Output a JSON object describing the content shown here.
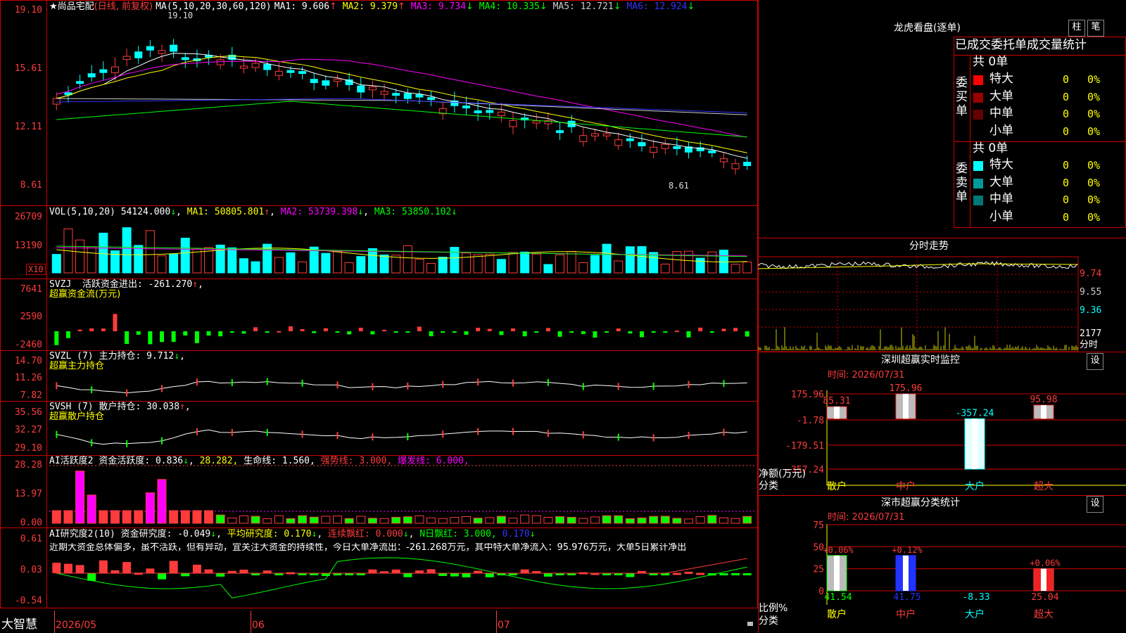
{
  "stock": {
    "star": "★",
    "name": "尚品宅配",
    "period": "(日线, 前复权)",
    "max_label": "19.10",
    "min_label": "8.61"
  },
  "ma": {
    "label": "MA(5,10,20,30,60,120)",
    "items": [
      {
        "text": "MA1: 9.606",
        "arrow": "↑",
        "color": "#ffffff"
      },
      {
        "text": "MA2: 9.379",
        "arrow": "↑",
        "color": "#ffff00"
      },
      {
        "text": "MA3: 9.734",
        "arrow": "↓",
        "color": "#ff00ff"
      },
      {
        "text": "MA4: 10.335",
        "arrow": "↓",
        "color": "#00ff00"
      },
      {
        "text": "MA5: 12.721",
        "arrow": "↓",
        "color": "#cccccc"
      },
      {
        "text": "MA6: 12.924",
        "arrow": "↓",
        "color": "#3333ff"
      }
    ]
  },
  "price_axis": [
    "19.10",
    "15.61",
    "12.11",
    "8.61"
  ],
  "vol": {
    "label": "VOL(5,10,20)",
    "value": "54124.000",
    "v_arrow": "↓",
    "ma1": "MA1: 50805.801",
    "ma1_arrow": "↑",
    "ma2": "MA2: 53739.398",
    "ma2_arrow": "↓",
    "ma3": "MA3: 53850.102",
    "ma3_arrow": "↓",
    "axis": [
      "26709",
      "13190"
    ],
    "unit": "X10"
  },
  "svzj": {
    "label": "SVZJ",
    "title": "活跃资金进出:",
    "value": "-261.270",
    "arrow": "↑",
    "sub": "超赢资金流(万元)",
    "axis": [
      "7641",
      "2590",
      "-2460"
    ]
  },
  "svzl": {
    "label": "SVZL (7)",
    "title": "主力持仓:",
    "value": "9.712",
    "arrow": "↓",
    "sub": "超赢主力持仓",
    "axis": [
      "14.70",
      "11.26",
      "7.82"
    ]
  },
  "svsh": {
    "label": "SVSH (7)",
    "title": "散户持仓:",
    "value": "30.038",
    "arrow": "↑",
    "sub": "超赢散户持仓",
    "axis": [
      "35.56",
      "32.27",
      "29.10"
    ]
  },
  "ai1": {
    "label": "AI活跃度2",
    "title": "资金活跃度:",
    "value": "0.836",
    "arrow": "↓",
    "v2": "28.282,",
    "life": "生命线: 1.560,",
    "strong": "强势线: 3.000,",
    "burst": "爆发线: 6.000,",
    "axis": [
      "28.28",
      "13.97",
      "0.00"
    ]
  },
  "ai2": {
    "label": "AI研究度2(10)",
    "title": "资金研究度:",
    "value": "-0.049",
    "arrow": "↓",
    "avg": "平均研究度: 0.170",
    "avg_arrow": "↓",
    "cont": "连续飘红: 0.000",
    "cont_arrow": "↓",
    "n": "N日飘红: 3.000,",
    "last": "0.170",
    "last_arrow": "↓",
    "comment": "近期大资金总体偏多，虽不活跃，但有异动，宜关注大资金的持续性，今日大单净流出：-261.268万元，其中特大单净流入：95.976万元，大单5日累计净出",
    "axis": [
      "0.61",
      "0.03",
      "-0.54"
    ]
  },
  "dates": [
    "2026/05",
    "06",
    "07"
  ],
  "brand": "大智慧",
  "dragon": {
    "title": "龙虎看盘(逐单)",
    "btn1": "柱",
    "btn2": "笔",
    "header": "已成交委托单成交量统计",
    "buy": {
      "side": "委买单",
      "total": "共 0单",
      "rows": [
        {
          "label": "特大",
          "vol": "0",
          "pct": "0%",
          "color": "#ff0000"
        },
        {
          "label": "大单",
          "vol": "0",
          "pct": "0%",
          "color": "#990000"
        },
        {
          "label": "中单",
          "vol": "0",
          "pct": "0%",
          "color": "#660000"
        },
        {
          "label": "小单",
          "vol": "0",
          "pct": "0%",
          "color": "#000000"
        }
      ]
    },
    "sell": {
      "side": "委卖单",
      "total": "共 0单",
      "rows": [
        {
          "label": "特大",
          "vol": "0",
          "pct": "0%",
          "color": "#00ffff"
        },
        {
          "label": "大单",
          "vol": "0",
          "pct": "0%",
          "color": "#009999"
        },
        {
          "label": "中单",
          "vol": "0",
          "pct": "0%",
          "color": "#007777"
        },
        {
          "label": "小单",
          "vol": "0",
          "pct": "0%",
          "color": "#000000"
        }
      ]
    }
  },
  "intraday": {
    "title": "分时走势",
    "axis": [
      "9.74",
      "9.55",
      "9.36"
    ],
    "vol_max": "2177",
    "vol_unit": "分时"
  },
  "monitor": {
    "title": "深圳超赢实时监控",
    "btn": "设",
    "time": "时间: 2026/07/31",
    "yaxis": [
      "175.96",
      "-1.78",
      "-179.51",
      "-357.24"
    ],
    "ylabel": "净额(万元)",
    "xlabel": "分类",
    "cats": [
      "散户",
      "中户",
      "大户",
      "超大"
    ],
    "values": [
      85.31,
      175.96,
      -357.24,
      95.98
    ],
    "value_labels": [
      "85.31",
      "175.96",
      "-357.24",
      "95.98"
    ]
  },
  "classify": {
    "title": "深市超赢分类统计",
    "btn": "设",
    "time": "时间: 2026/07/31",
    "yaxis": [
      "75",
      "50",
      "25",
      "0"
    ],
    "ylabel": "比例%",
    "xlabel": "分类",
    "cats": [
      "散户",
      "中户",
      "大户",
      "超大"
    ],
    "values": [
      41.54,
      41.75,
      -8.33,
      25.04
    ],
    "value_labels": [
      "41.54",
      "41.75",
      "-8.33",
      "25.04"
    ],
    "changes": [
      "+0.06%",
      "+0.12%",
      "",
      "+0.06%"
    ]
  }
}
